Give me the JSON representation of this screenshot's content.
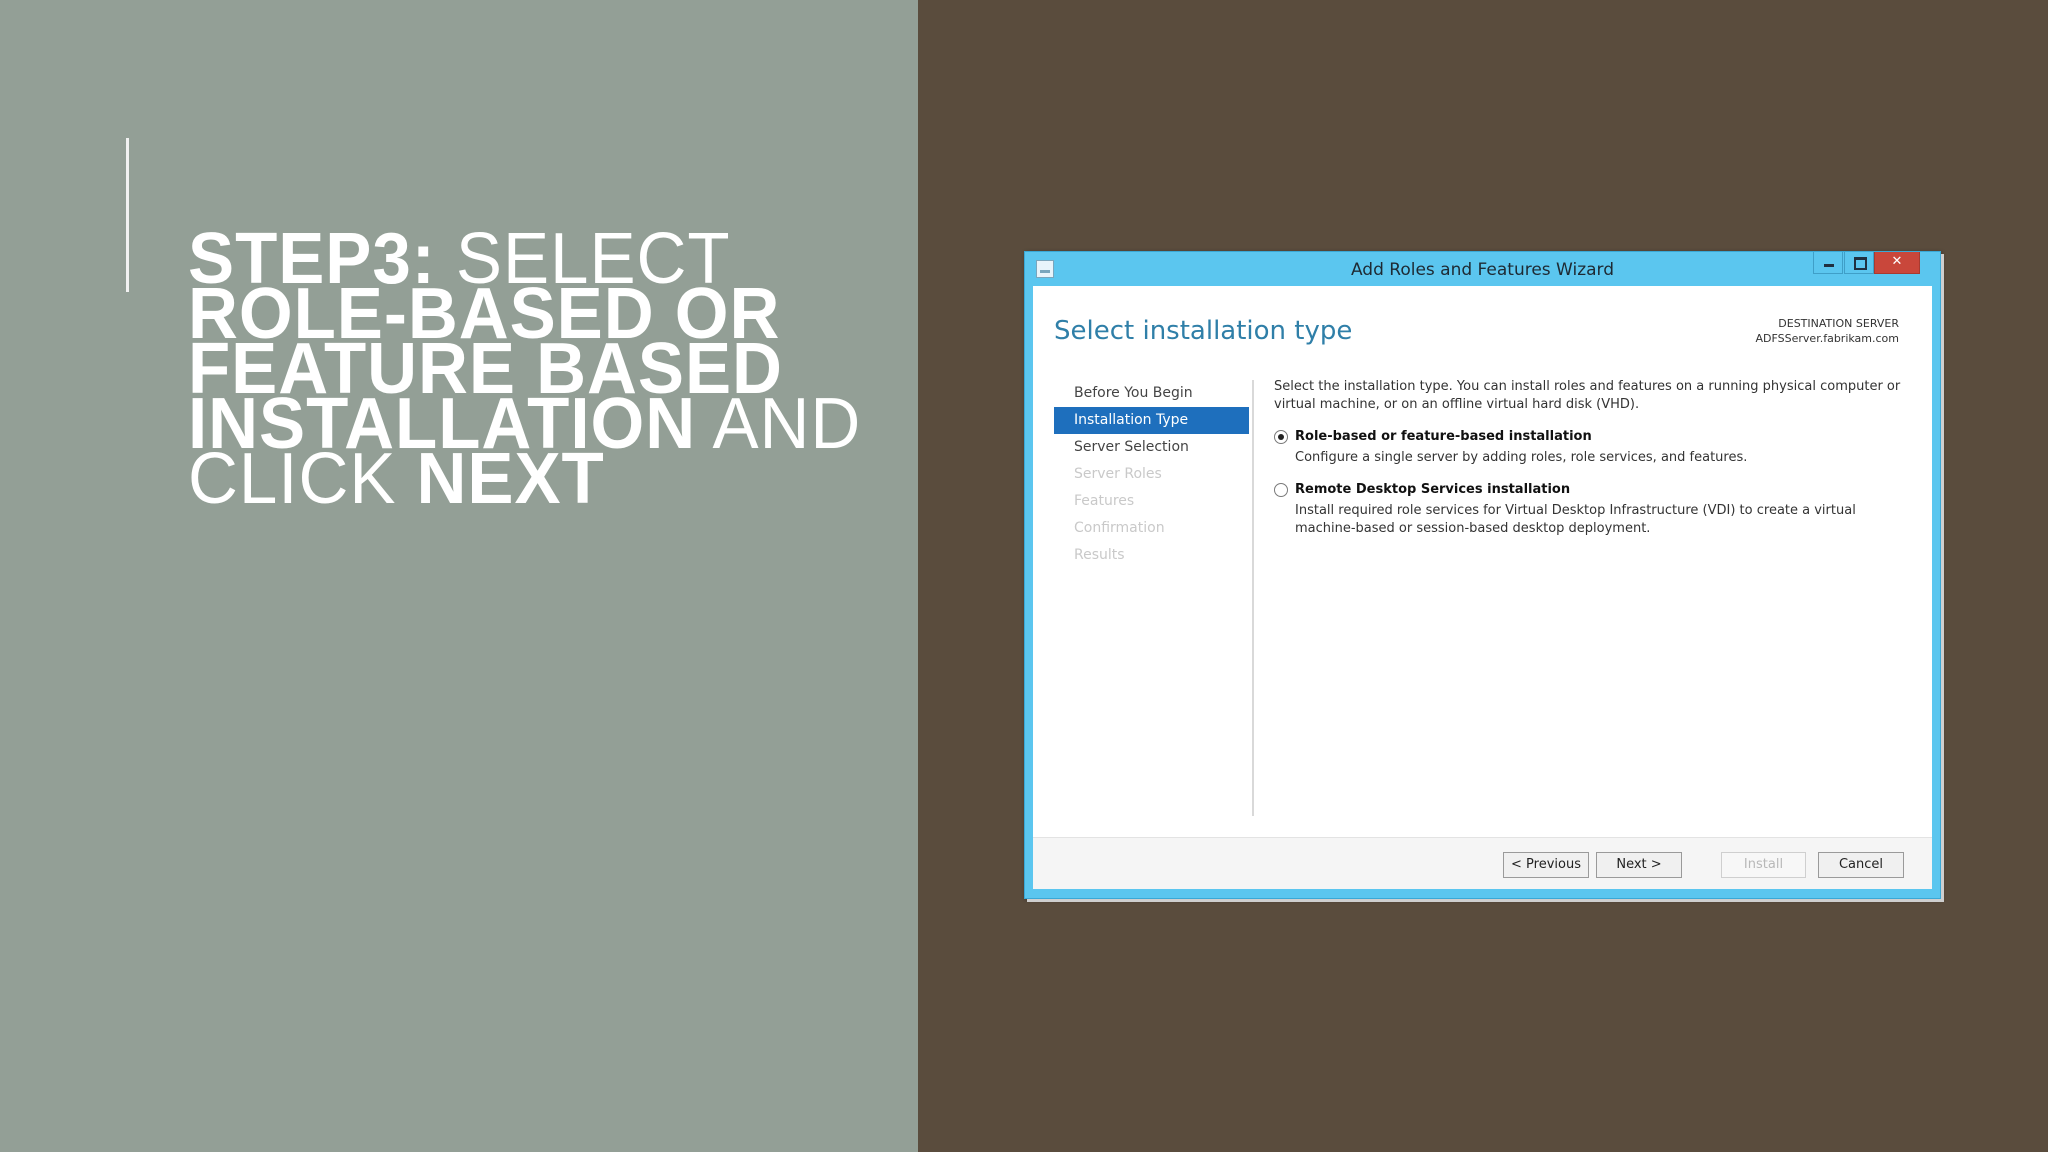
{
  "slide": {
    "title_lines": [
      [
        {
          "text": "STEP3: ",
          "bold": true
        },
        {
          "text": "SELECT",
          "bold": false
        }
      ],
      [
        {
          "text": "ROLE-BASED OR",
          "bold": true
        }
      ],
      [
        {
          "text": "FEATURE BASED",
          "bold": true
        }
      ],
      [
        {
          "text": "INSTALLATION",
          "bold": true
        },
        {
          "text": " AND",
          "bold": false
        }
      ],
      [
        {
          "text": "CLICK ",
          "bold": false
        },
        {
          "text": "NEXT",
          "bold": true
        }
      ]
    ],
    "colors": {
      "left_bg": "#939f96",
      "right_bg": "#5a4c3d",
      "title": "#ffffff"
    }
  },
  "wizard": {
    "window_title": "Add Roles and Features Wizard",
    "window_buttons": {
      "close": "✕"
    },
    "page_heading": "Select installation type",
    "destination": {
      "label": "DESTINATION SERVER",
      "server": "ADFSServer.fabrikam.com"
    },
    "nav": [
      {
        "label": "Before You Begin",
        "state": "normal"
      },
      {
        "label": "Installation Type",
        "state": "active"
      },
      {
        "label": "Server Selection",
        "state": "normal"
      },
      {
        "label": "Server Roles",
        "state": "disabled"
      },
      {
        "label": "Features",
        "state": "disabled"
      },
      {
        "label": "Confirmation",
        "state": "disabled"
      },
      {
        "label": "Results",
        "state": "disabled"
      }
    ],
    "intro": "Select the installation type. You can install roles and features on a running physical computer or virtual machine, or on an offline virtual hard disk (VHD).",
    "options": [
      {
        "title": "Role-based or feature-based installation",
        "description": "Configure a single server by adding roles, role services, and features.",
        "selected": true
      },
      {
        "title": "Remote Desktop Services installation",
        "description": "Install required role services for Virtual Desktop Infrastructure (VDI) to create a virtual machine-based or session-based desktop deployment.",
        "selected": false
      }
    ],
    "buttons": {
      "previous": "< Previous",
      "next": "Next >",
      "install": "Install",
      "cancel": "Cancel"
    },
    "colors": {
      "frame": "#5bc6ef",
      "heading": "#2f7fa8",
      "active_nav": "#1e6fbd",
      "close_button": "#c9473b"
    }
  }
}
